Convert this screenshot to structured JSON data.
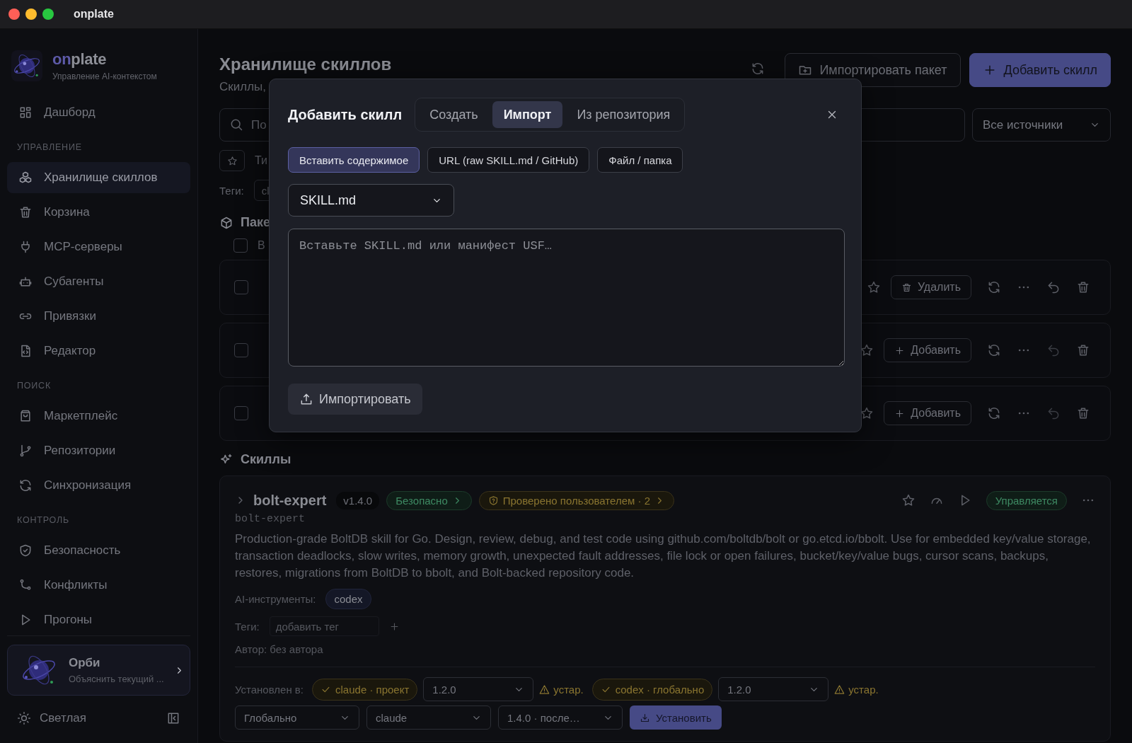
{
  "window": {
    "title": "onplate"
  },
  "sidebar": {
    "brand": {
      "accent": "on",
      "rest": "plate",
      "subtitle": "Управление AI-контекстом"
    },
    "nav": [
      {
        "items": [
          {
            "label": "Дашборд",
            "selected": false
          }
        ]
      },
      {
        "heading": "УПРАВЛЕНИЕ",
        "items": [
          {
            "label": "Хранилище скиллов",
            "selected": true
          },
          {
            "label": "Корзина",
            "selected": false
          },
          {
            "label": "MCP-серверы",
            "selected": false
          },
          {
            "label": "Субагенты",
            "selected": false
          },
          {
            "label": "Привязки",
            "selected": false
          },
          {
            "label": "Редактор",
            "selected": false
          }
        ]
      },
      {
        "heading": "ПОИСК",
        "items": [
          {
            "label": "Маркетплейс",
            "selected": false
          },
          {
            "label": "Репозитории",
            "selected": false
          },
          {
            "label": "Синхронизация",
            "selected": false
          }
        ]
      },
      {
        "heading": "КОНТРОЛЬ",
        "items": [
          {
            "label": "Безопасность",
            "selected": false
          },
          {
            "label": "Конфликты",
            "selected": false
          },
          {
            "label": "Прогоны",
            "selected": false
          }
        ]
      }
    ],
    "assistant": {
      "name": "Орби",
      "hint": "Объяснить текущий ..."
    },
    "theme_toggle": {
      "label": "Светлая"
    }
  },
  "header": {
    "title": "Хранилище скиллов",
    "subtitle": "Скиллы,",
    "buttons": [
      {
        "kind": "outline",
        "label": "Импортировать пакет"
      },
      {
        "kind": "primary",
        "label": "Добавить скилл"
      }
    ]
  },
  "search": {
    "placeholder": "По"
  },
  "source_filter": {
    "value": "Все источники"
  },
  "type_filter": {
    "label": "Ти"
  },
  "tags_filter": {
    "label": "Теги:",
    "chip": "cl"
  },
  "packages": {
    "title": "Паке",
    "select_all": {
      "label": "В",
      "checked": false
    },
    "rows": [
      {
        "checked": false,
        "action": {
          "kind": "remove",
          "label": "Удалить"
        },
        "undo_enabled": true
      },
      {
        "checked": false,
        "action": {
          "kind": "add",
          "label": "Добавить"
        },
        "undo_enabled": false
      },
      {
        "checked": false,
        "action": {
          "kind": "add",
          "label": "Добавить"
        },
        "undo_enabled": false
      }
    ]
  },
  "skills": {
    "title": "Скиллы",
    "items": [
      {
        "name": "bolt-expert",
        "expanded": false,
        "version": "v1.4.0",
        "badges": [
          {
            "kind": "safe",
            "label": "Безопасно"
          },
          {
            "kind": "verified",
            "label": "Проверено пользователем · 2"
          }
        ],
        "status": "Управляется",
        "slug": "bolt-expert",
        "description": "Production-grade BoltDB skill for Go. Design, review, debug, and test code using github.com/boltdb/bolt or go.etcd.io/bbolt. Use for embedded key/value storage, transaction deadlocks, slow writes, memory growth, unexpected fault addresses, file lock or open failures, bucket/key/value bugs, cursor scans, backups, restores, migrations from BoltDB to bbolt, and Bolt-backed repository code.",
        "tools_label": "AI-инструменты:",
        "tools": [
          "codex"
        ],
        "tags_label": "Теги:",
        "tag_placeholder": "добавить тег",
        "author": "Автор: без автора",
        "installed_label": "Установлен в:",
        "installs": [
          {
            "target": "claude · проект",
            "version": "1.2.0",
            "note": "устар."
          },
          {
            "target": "codex · глобально",
            "version": "1.2.0",
            "note": "устар."
          }
        ],
        "install_row": {
          "scope": "Глобально",
          "tool": "claude",
          "version": "1.4.0 · после…",
          "button": "Установить"
        }
      }
    ]
  },
  "modal": {
    "title": "Добавить скилл",
    "tabs": [
      {
        "label": "Создать",
        "selected": false
      },
      {
        "label": "Импорт",
        "selected": true
      },
      {
        "label": "Из репозитория",
        "selected": false
      }
    ],
    "sources": [
      {
        "label": "Вставить содержимое",
        "selected": true
      },
      {
        "label": "URL (raw SKILL.md / GitHub)",
        "selected": false
      },
      {
        "label": "Файл / папка",
        "selected": false
      }
    ],
    "format": {
      "value": "SKILL.md"
    },
    "content": {
      "placeholder": "Вставьте SKILL.md или манифест USF…"
    },
    "submit": {
      "label": "Импортировать"
    }
  }
}
